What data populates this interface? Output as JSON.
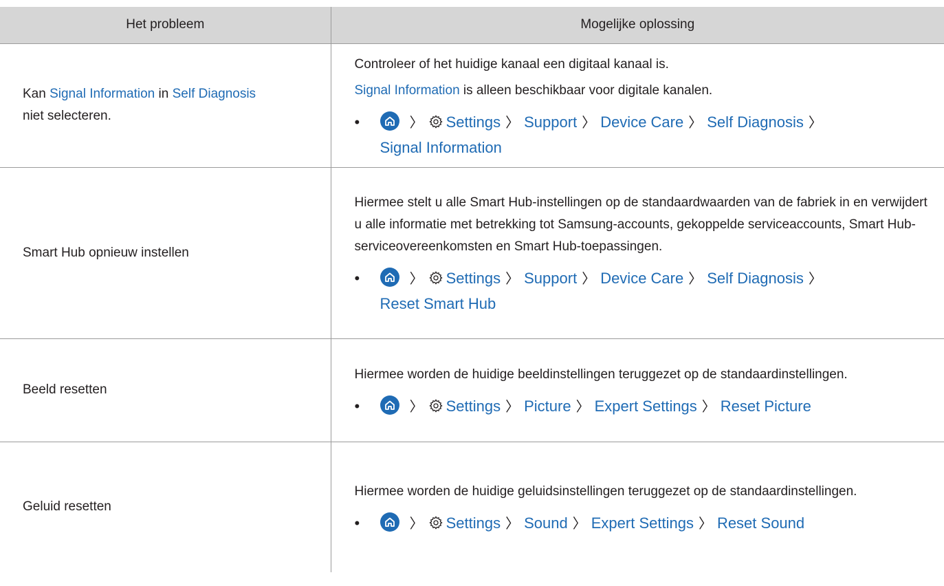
{
  "header": {
    "col1": "Het probleem",
    "col2": "Mogelijke oplossing"
  },
  "rows": [
    {
      "problem": {
        "pre": "Kan ",
        "link1": "Signal Information",
        "mid": " in ",
        "link2": "Self Diagnosis",
        "post": "niet selecteren."
      },
      "para1": "Controleer of het huidige kanaal een digitaal kanaal is.",
      "para2_link": "Signal Information",
      "para2_rest": " is alleen beschikbaar voor digitale kanalen.",
      "path": [
        "Settings",
        "Support",
        "Device Care",
        "Self Diagnosis",
        "Signal Information"
      ]
    },
    {
      "problem": "Smart Hub opnieuw instellen",
      "para1": "Hiermee stelt u alle Smart Hub-instellingen op de standaardwaarden van de fabriek in en verwijdert u alle informatie met betrekking tot Samsung-accounts, gekoppelde serviceaccounts, Smart Hub-serviceovereenkomsten en Smart Hub-toepassingen.",
      "path": [
        "Settings",
        "Support",
        "Device Care",
        "Self Diagnosis",
        "Reset Smart Hub"
      ]
    },
    {
      "problem": "Beeld resetten",
      "para1": "Hiermee worden de huidige beeldinstellingen teruggezet op de standaardinstellingen.",
      "path": [
        "Settings",
        "Picture",
        "Expert Settings",
        "Reset Picture"
      ]
    },
    {
      "problem": "Geluid resetten",
      "para1": "Hiermee worden de huidige geluidsinstellingen teruggezet op de standaardinstellingen.",
      "path": [
        "Settings",
        "Sound",
        "Expert Settings",
        "Reset Sound"
      ]
    }
  ],
  "symbols": {
    "bullet": "•",
    "chevron": "〉"
  },
  "colors": {
    "link": "#1f6bb4",
    "header_bg": "#d6d6d6",
    "rule": "#9b9b9b"
  }
}
